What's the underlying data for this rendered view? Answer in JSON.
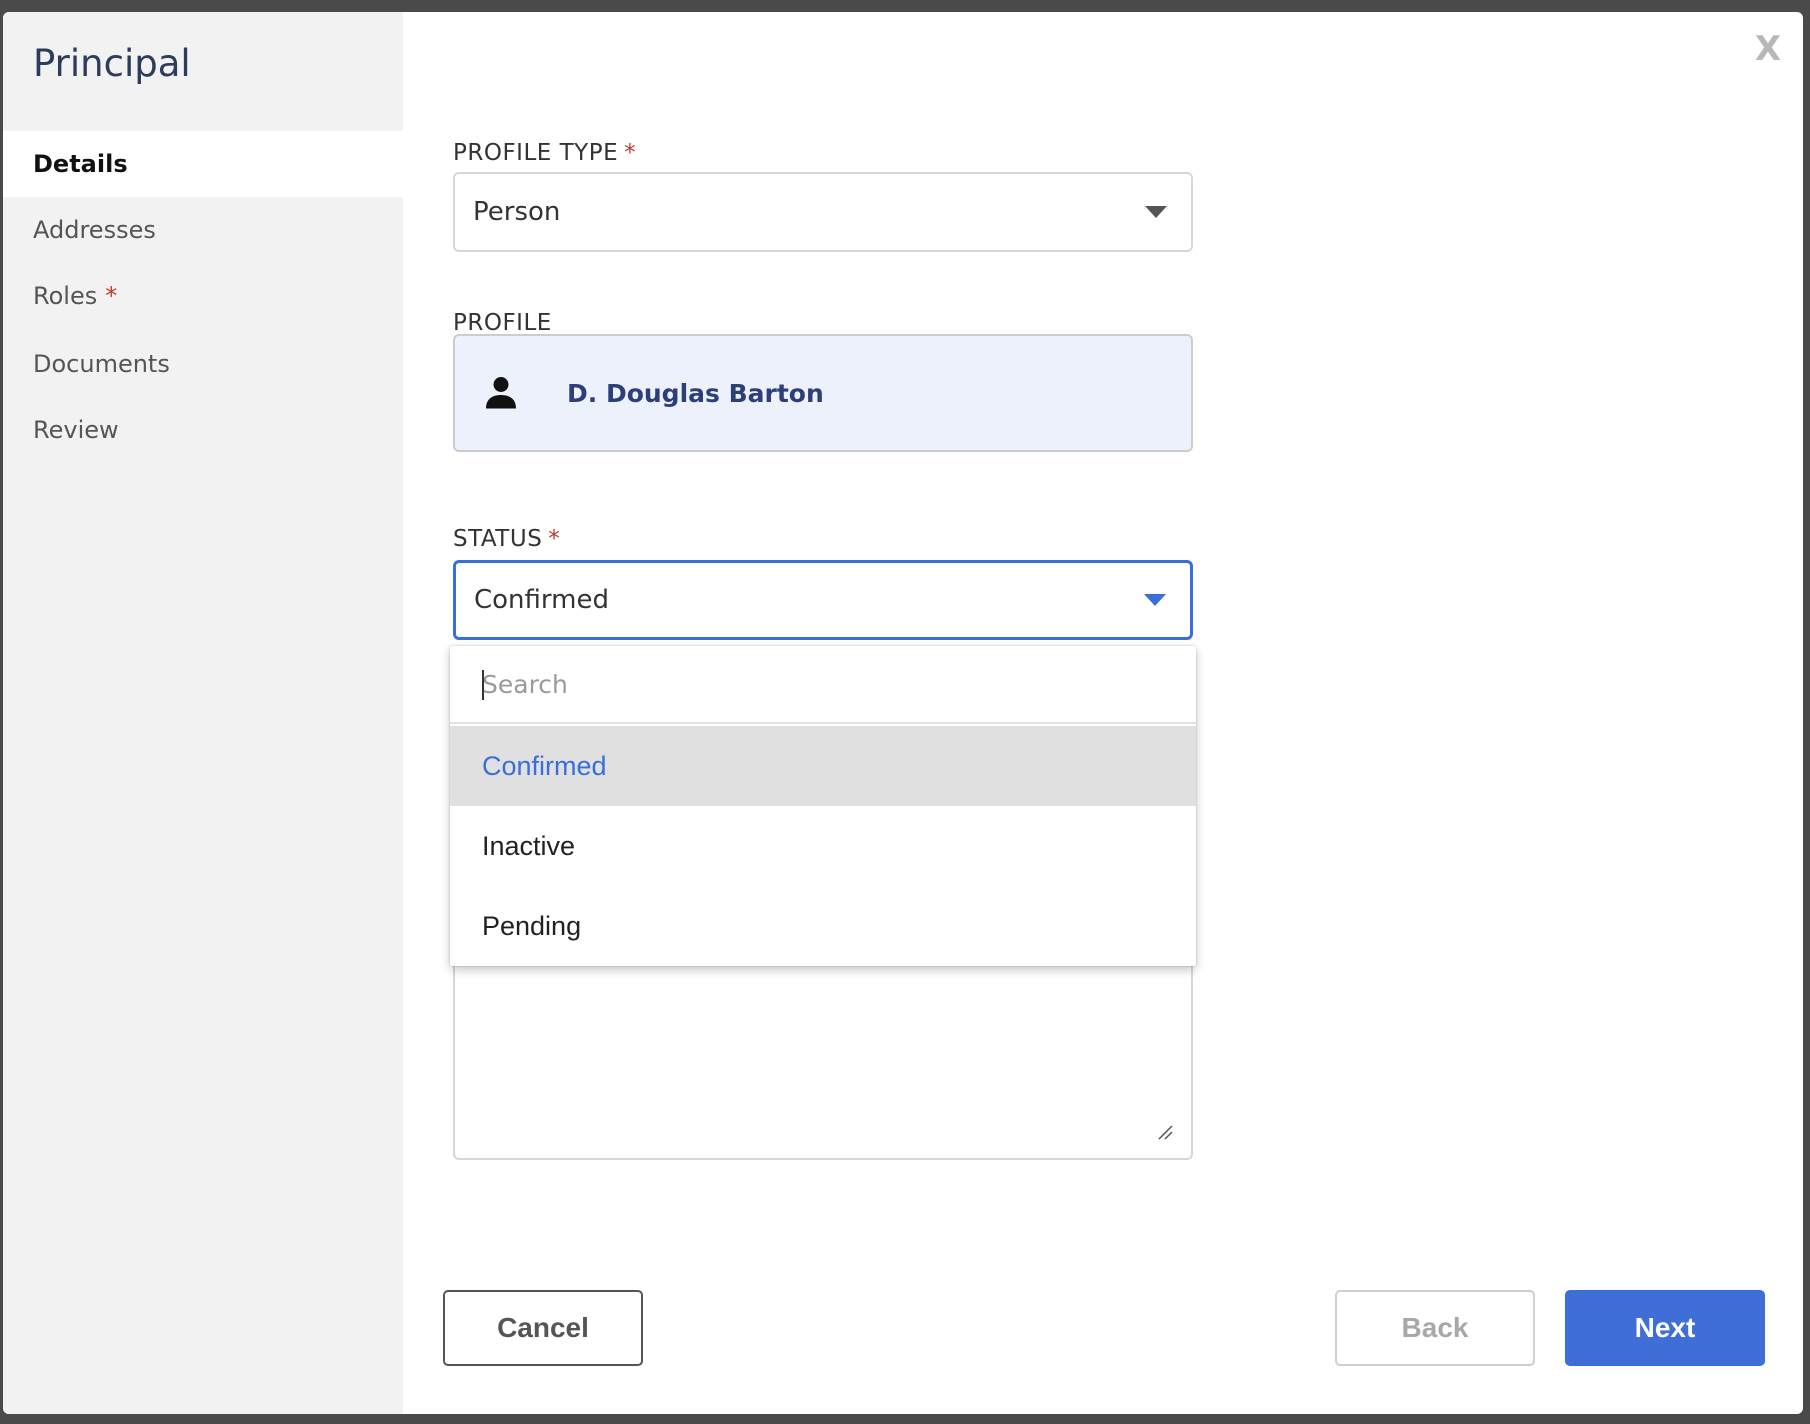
{
  "sidebar": {
    "title": "Principal",
    "items": [
      {
        "label": "Details",
        "required": ""
      },
      {
        "label": "Addresses",
        "required": ""
      },
      {
        "label": "Roles",
        "required": "*"
      },
      {
        "label": "Documents",
        "required": ""
      },
      {
        "label": "Review",
        "required": ""
      }
    ]
  },
  "close": {
    "label": "X"
  },
  "form": {
    "profile_type": {
      "label": "PROFILE TYPE",
      "required": "*",
      "value": "Person"
    },
    "profile": {
      "label": "PROFILE",
      "name": "D. Douglas Barton"
    },
    "status": {
      "label": "STATUS",
      "required": "*",
      "value": "Confirmed"
    }
  },
  "dropdown": {
    "search_placeholder": "Search",
    "options": [
      {
        "label": "Confirmed",
        "selected": true
      },
      {
        "label": "Inactive",
        "selected": false
      },
      {
        "label": "Pending",
        "selected": false
      }
    ]
  },
  "footer": {
    "cancel_label": "Cancel",
    "back_label": "Back",
    "next_label": "Next"
  },
  "colors": {
    "accent": "#3f6fd6",
    "required": "#c0392b",
    "sidebar_bg": "#f2f2f2",
    "profile_bg": "#edf1fb"
  },
  "icons": {
    "close": "close-icon",
    "profile": "person-icon",
    "caret": "chevron-down-icon",
    "resize": "resize-handle-icon"
  }
}
